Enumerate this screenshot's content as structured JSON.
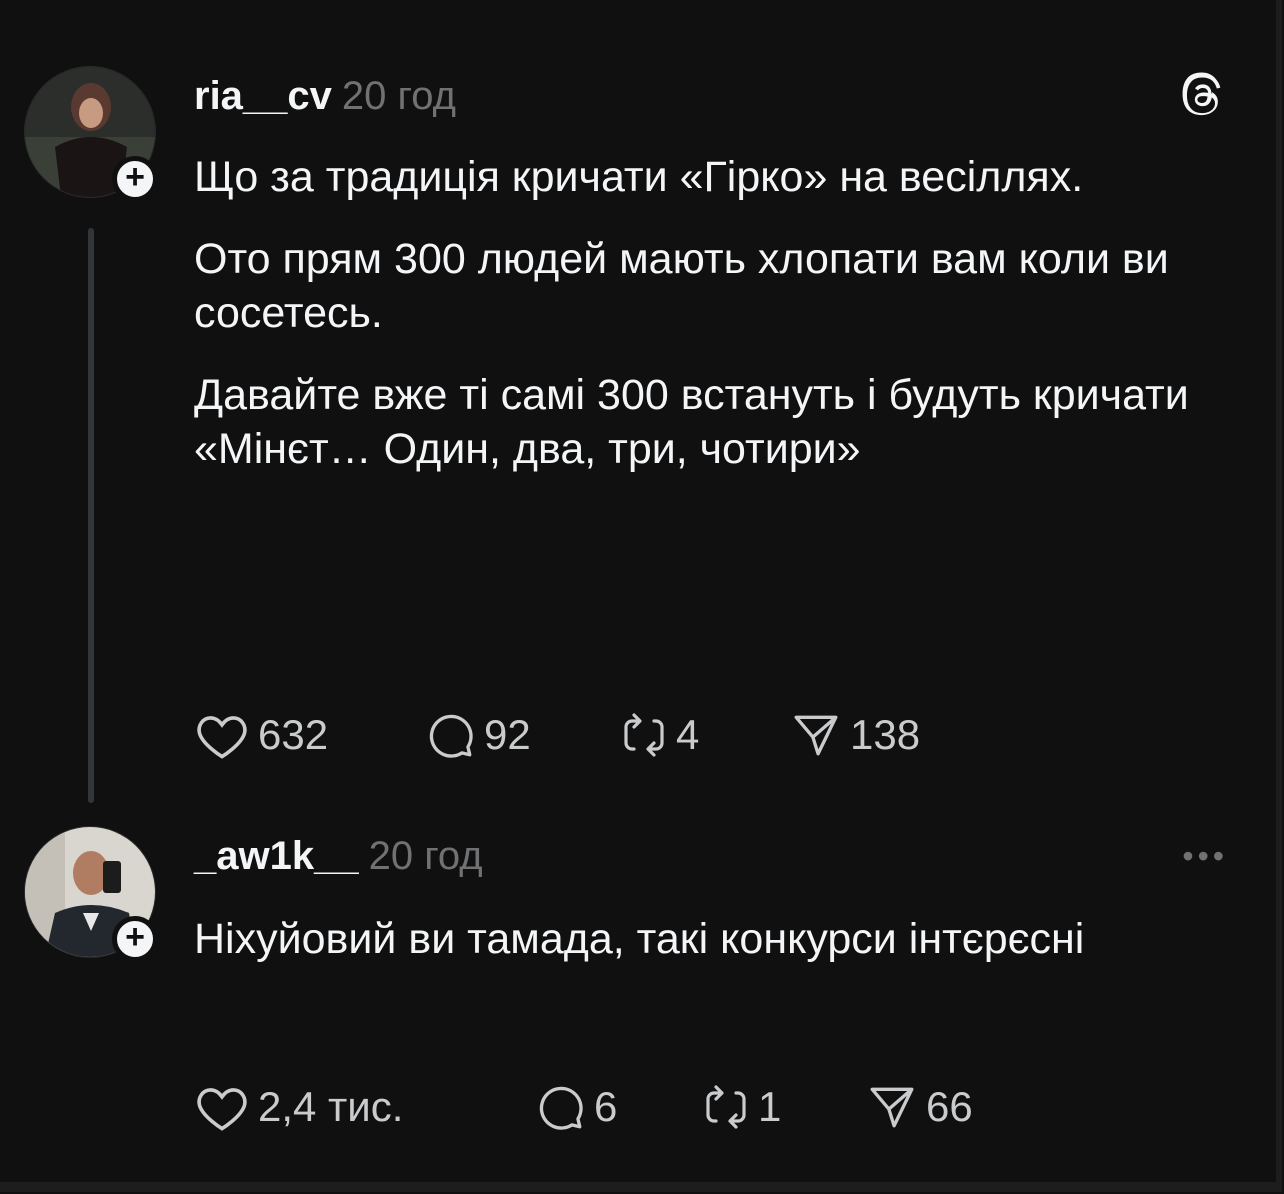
{
  "posts": [
    {
      "username": "ria__cv",
      "time": "20 год",
      "paragraphs": [
        "Що за традиція кричати «Гірко» на весіллях.",
        "Ото прям 300 людей мають хлопати вам коли ви сосетесь.",
        "Давайте вже ті самі 300 встануть і будуть кричати «Мінєт… Один, два, три, чотири»"
      ],
      "likes": "632",
      "replies": "92",
      "reposts": "4",
      "shares": "138",
      "corner_icon": "threads-logo-icon"
    },
    {
      "username": "_aw1k__",
      "time": "20 год",
      "paragraphs": [
        "Ніхуйовий ви тамада, такі конкурси інтєрєсні"
      ],
      "likes": "2,4 тис.",
      "replies": "6",
      "reposts": "1",
      "shares": "66",
      "corner_icon": "more-options-icon",
      "more_label": "•••"
    }
  ],
  "follow_badge_label": "+",
  "colors": {
    "background": "#101010",
    "text_primary": "#f3f5f7",
    "text_secondary": "#6f7173",
    "thread_line": "#333638"
  }
}
